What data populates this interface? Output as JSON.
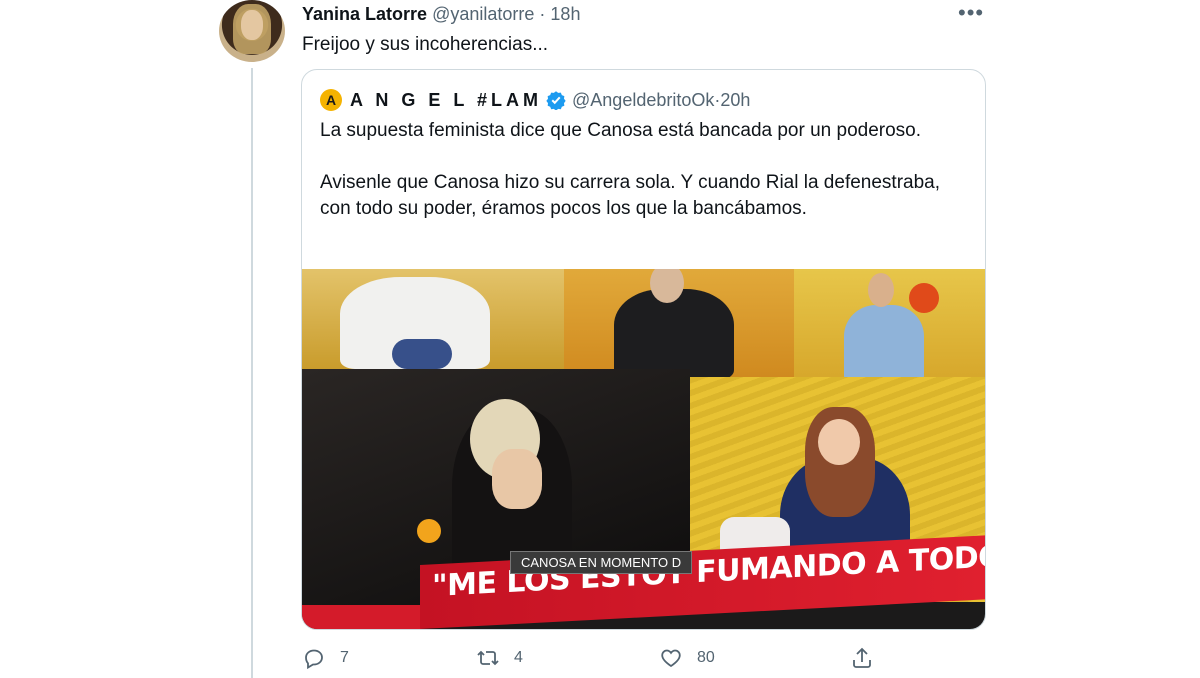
{
  "tweet": {
    "author_name": "Yanina Latorre",
    "handle": "@yanilatorre",
    "separator": "·",
    "time": "18h",
    "more_icon": "more-horizontal-icon",
    "text": "Freijoo y sus incoherencias...",
    "actions": {
      "replies": "7",
      "retweets": "4",
      "likes": "80"
    }
  },
  "quoted": {
    "avatar_letter": "A",
    "author_name": "A N G E L #LAM",
    "verified_icon": "verified-badge-icon",
    "handle": "@AngeldebritoOk",
    "separator": "·",
    "time": "20h",
    "paragraph1": "La supuesta feminista dice que Canosa está bancada por un poderoso.",
    "paragraph2": "Avisenle que Canosa hizo su carrera sola. Y cuando Rial la defenestraba, con todo su poder, éramos pocos los que la bancábamos.",
    "media": {
      "chyron": "CANOSA EN MOMENTO D",
      "banner": "\"ME LOS ESTOY FUMANDO A TODOS\""
    }
  },
  "colors": {
    "text": "#0f1419",
    "secondary": "#536471",
    "border": "#cfd9de",
    "verified": "#1d9bf0",
    "banner": "#d41b2a"
  }
}
